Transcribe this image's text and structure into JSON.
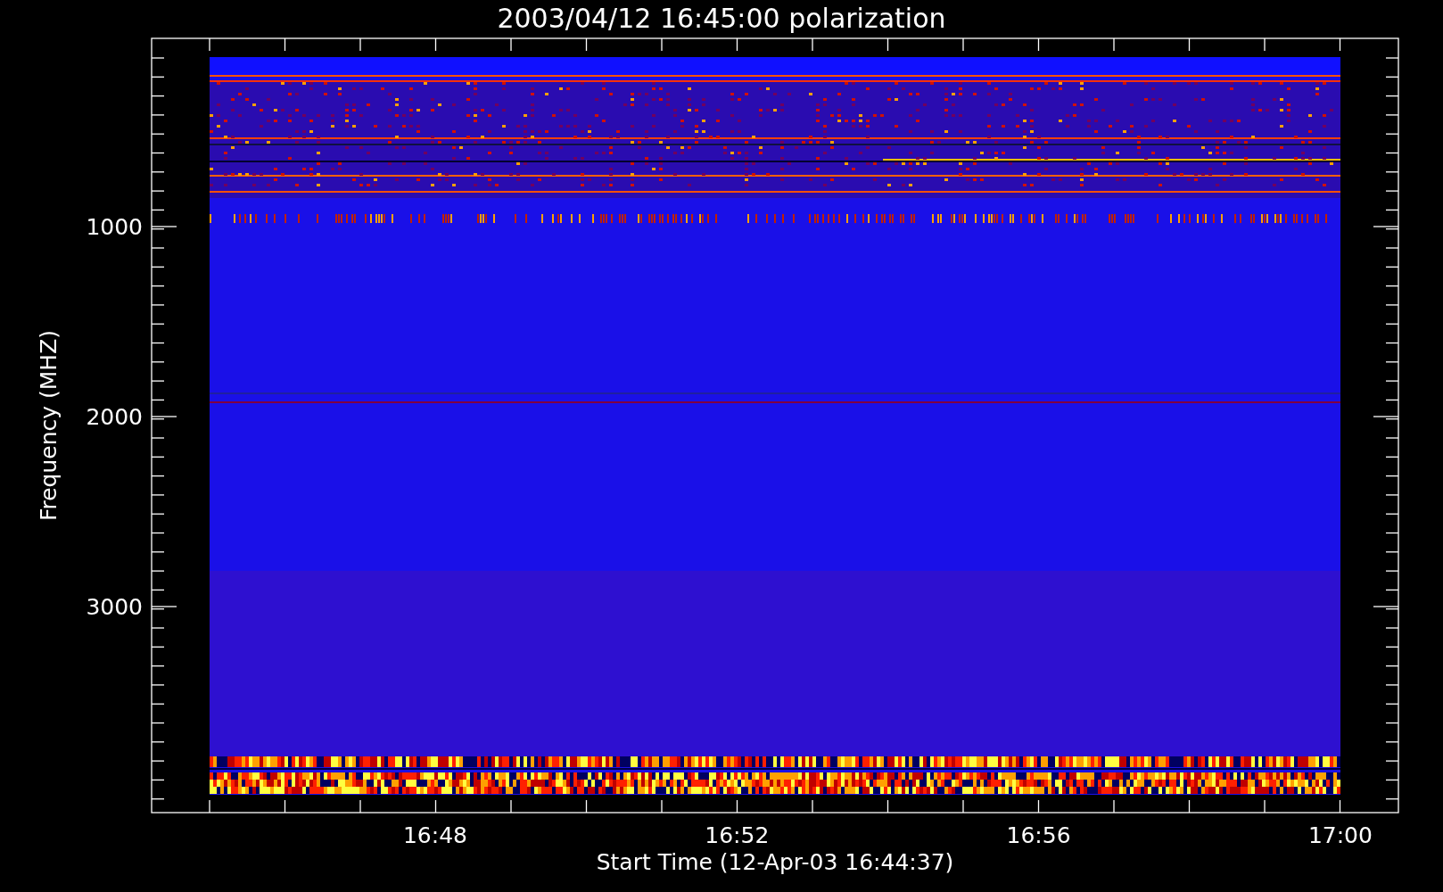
{
  "title": "2003/04/12 16:45:00 polarization",
  "y_axis": {
    "label": "Frequency (MHZ)",
    "ticks": [
      "1000",
      "2000",
      "3000"
    ]
  },
  "x_axis": {
    "label": "Start Time (12-Apr-03 16:44:37)",
    "ticks": [
      "16:48",
      "16:52",
      "16:56",
      "17:00"
    ]
  }
}
